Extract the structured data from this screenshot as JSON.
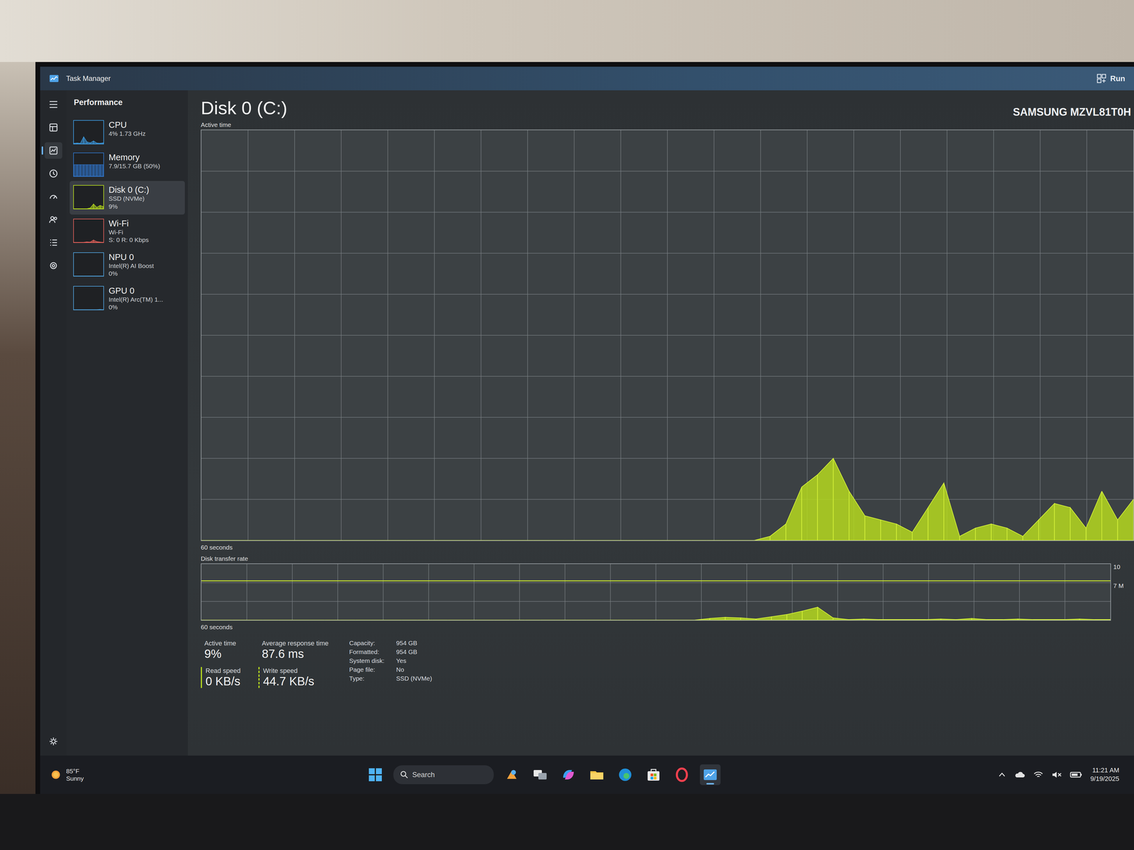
{
  "window": {
    "title": "Task Manager",
    "run_button": "Run"
  },
  "nav": [
    {
      "kind": "menu",
      "selected": false
    },
    {
      "kind": "processes",
      "selected": false
    },
    {
      "kind": "performance",
      "selected": true
    },
    {
      "kind": "history",
      "selected": false
    },
    {
      "kind": "startup",
      "selected": false
    },
    {
      "kind": "users",
      "selected": false
    },
    {
      "kind": "details",
      "selected": false
    },
    {
      "kind": "services",
      "selected": false
    },
    {
      "kind": "settings",
      "selected": false
    }
  ],
  "page_title": "Performance",
  "sidebar": {
    "items": [
      {
        "name": "CPU",
        "lines": [
          "4% 1.73 GHz"
        ],
        "selected": false,
        "color": "#3d9be0",
        "values": [
          2,
          3,
          2,
          30,
          8,
          4,
          12,
          3,
          2,
          4
        ]
      },
      {
        "name": "Memory",
        "lines": [
          "7.9/15.7 GB (50%)"
        ],
        "selected": false,
        "color": "#2f74c8",
        "values": [
          50,
          50,
          50,
          50,
          50,
          50,
          50,
          50,
          50,
          50
        ]
      },
      {
        "name": "Disk 0 (C:)",
        "lines": [
          "SSD (NVMe)",
          "9%"
        ],
        "selected": true,
        "color": "#b5d91f",
        "values": [
          0,
          0,
          0,
          0,
          0,
          3,
          20,
          6,
          14,
          9
        ]
      },
      {
        "name": "Wi-Fi",
        "lines": [
          "Wi-Fi",
          "S: 0 R: 0 Kbps"
        ],
        "selected": false,
        "color": "#e0605a",
        "values": [
          0,
          0,
          0,
          0,
          2,
          1,
          10,
          3,
          1,
          0
        ]
      },
      {
        "name": "NPU 0",
        "lines": [
          "Intel(R) AI Boost",
          "0%"
        ],
        "selected": false,
        "color": "#4f9fd8",
        "values": [
          0,
          0,
          0,
          0,
          0,
          0,
          0,
          0,
          0,
          0
        ]
      },
      {
        "name": "GPU 0",
        "lines": [
          "Intel(R) Arc(TM) 1...",
          "0%"
        ],
        "selected": false,
        "color": "#4f9fd8",
        "values": [
          0,
          0,
          0,
          0,
          0,
          0,
          0,
          0,
          1,
          0
        ]
      }
    ]
  },
  "main": {
    "title": "Disk 0 (C:)",
    "model": "SAMSUNG MZVL81T0H"
  },
  "active_chart": {
    "label": "Active time",
    "span": "60 seconds",
    "max": 100,
    "values": [
      0,
      0,
      0,
      0,
      0,
      0,
      0,
      0,
      0,
      0,
      0,
      0,
      0,
      0,
      0,
      0,
      0,
      0,
      0,
      0,
      0,
      0,
      0,
      0,
      0,
      0,
      0,
      0,
      0,
      0,
      0,
      0,
      0,
      0,
      0,
      0,
      1,
      4,
      13,
      16,
      20,
      12,
      6,
      5,
      4,
      2,
      8,
      14,
      1,
      3,
      4,
      3,
      1,
      5,
      9,
      8,
      3,
      12,
      5,
      10
    ]
  },
  "transfer_chart": {
    "label": "Disk transfer rate",
    "span": "60 seconds",
    "max": 10,
    "reference": 7,
    "ticks": [
      "10",
      "7 M"
    ],
    "values": [
      0,
      0,
      0,
      0,
      0,
      0,
      0,
      0,
      0,
      0,
      0,
      0,
      0,
      0,
      0,
      0,
      0,
      0,
      0,
      0,
      0,
      0,
      0,
      0,
      0,
      0,
      0,
      0,
      0,
      0,
      0,
      0,
      0,
      0.3,
      0.5,
      0.4,
      0.2,
      0.6,
      1.0,
      1.6,
      2.3,
      0.4,
      0.1,
      0.2,
      0.1,
      0.1,
      0.1,
      0.1,
      0.2,
      0.1,
      0.3,
      0.1,
      0.1,
      0.2,
      0.1,
      0.1,
      0.1,
      0.2,
      0.1,
      0.1
    ]
  },
  "stats": [
    {
      "label": "Active time",
      "value": "9%",
      "kind": "plain"
    },
    {
      "label": "Average response time",
      "value": "87.6 ms",
      "kind": "plain"
    },
    {
      "label": "Read speed",
      "value": "0 KB/s",
      "kind": "read"
    },
    {
      "label": "Write speed",
      "value": "44.7 KB/s",
      "kind": "write"
    }
  ],
  "properties": [
    {
      "label": "Capacity:",
      "value": "954 GB"
    },
    {
      "label": "Formatted:",
      "value": "954 GB"
    },
    {
      "label": "System disk:",
      "value": "Yes"
    },
    {
      "label": "Page file:",
      "value": "No"
    },
    {
      "label": "Type:",
      "value": "SSD (NVMe)"
    }
  ],
  "taskbar": {
    "weather": {
      "temp": "85°F",
      "condition": "Sunny"
    },
    "search": "Search",
    "apps": [
      {
        "kind": "start",
        "selected": false
      },
      {
        "kind": "search",
        "selected": false
      },
      {
        "kind": "widget",
        "selected": false
      },
      {
        "kind": "taskview",
        "selected": false
      },
      {
        "kind": "copilot",
        "selected": false
      },
      {
        "kind": "explorer",
        "selected": false
      },
      {
        "kind": "edge",
        "selected": false
      },
      {
        "kind": "store",
        "selected": false
      },
      {
        "kind": "opera",
        "selected": false
      },
      {
        "kind": "taskmanager",
        "selected": true
      }
    ],
    "time": "11:21 AM",
    "date": "9/19/2025"
  }
}
